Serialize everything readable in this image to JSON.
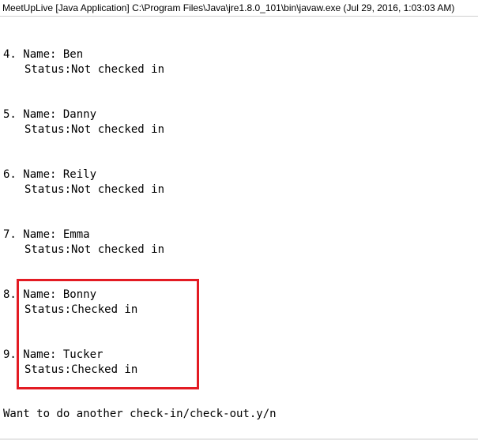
{
  "window": {
    "title": "MeetUpLive [Java Application] C:\\Program Files\\Java\\jre1.8.0_101\\bin\\javaw.exe (Jul 29, 2016, 1:03:03 AM)"
  },
  "entries": [
    {
      "number": "4.",
      "name": "Name: Ben",
      "status": "Status:Not checked in"
    },
    {
      "number": "5.",
      "name": "Name: Danny",
      "status": "Status:Not checked in"
    },
    {
      "number": "6.",
      "name": "Name: Reily",
      "status": "Status:Not checked in"
    },
    {
      "number": "7.",
      "name": "Name: Emma",
      "status": "Status:Not checked in"
    },
    {
      "number": "8.",
      "name": "Name: Bonny",
      "status": "Status:Checked in"
    },
    {
      "number": "9.",
      "name": "Name: Tucker",
      "status": "Status:Checked in"
    }
  ],
  "prompt": "Want to do another check-in/check-out.y/n",
  "highlight_color": "#e31b23"
}
